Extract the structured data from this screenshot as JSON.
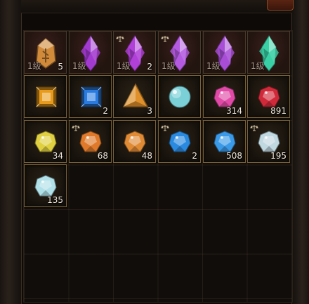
{
  "inventory": {
    "accent": "#7a6236",
    "items": [
      {
        "name": "amber-rune",
        "level": "1级",
        "count": "5",
        "locked": false,
        "color": "#d08a3a"
      },
      {
        "name": "violet-crystal",
        "level": "1级",
        "count": "",
        "locked": false,
        "color": "#a23ad0"
      },
      {
        "name": "violet-crystal-cluster",
        "level": "1级",
        "count": "2",
        "locked": true,
        "color": "#b040d8"
      },
      {
        "name": "violet-crystal-shard",
        "level": "1级",
        "count": "",
        "locked": true,
        "color": "#b45ae0"
      },
      {
        "name": "violet-crystal-shard-2",
        "level": "1级",
        "count": "",
        "locked": false,
        "color": "#a84ed6"
      },
      {
        "name": "teal-crystal",
        "level": "1级",
        "count": "",
        "locked": false,
        "color": "#3ad0a6"
      },
      {
        "name": "topaz-square-gem",
        "level": "",
        "count": "",
        "locked": false,
        "color": "#e89a1a"
      },
      {
        "name": "sapphire-square-gem",
        "level": "",
        "count": "2",
        "locked": false,
        "color": "#2a7be0"
      },
      {
        "name": "amber-triangle-gem",
        "level": "",
        "count": "3",
        "locked": false,
        "color": "#e0902a"
      },
      {
        "name": "cyan-orb",
        "level": "",
        "count": "",
        "locked": false,
        "color": "#7ad0d6"
      },
      {
        "name": "pink-gem",
        "level": "",
        "count": "314",
        "locked": false,
        "color": "#e04aa6"
      },
      {
        "name": "ruby-gem",
        "level": "",
        "count": "891",
        "locked": false,
        "color": "#d02a3a"
      },
      {
        "name": "yellow-gem",
        "level": "",
        "count": "34",
        "locked": false,
        "color": "#e0d040"
      },
      {
        "name": "orange-gem",
        "level": "",
        "count": "68",
        "locked": true,
        "color": "#e07a2a"
      },
      {
        "name": "orange-gem-2",
        "level": "",
        "count": "48",
        "locked": false,
        "color": "#e08a34"
      },
      {
        "name": "blue-gem",
        "level": "",
        "count": "2",
        "locked": true,
        "color": "#2a8ae0"
      },
      {
        "name": "blue-gem-2",
        "level": "",
        "count": "508",
        "locked": false,
        "color": "#3a9ae8"
      },
      {
        "name": "white-gem",
        "level": "",
        "count": "195",
        "locked": true,
        "color": "#c0d8e0"
      },
      {
        "name": "aqua-gem",
        "level": "",
        "count": "135",
        "locked": false,
        "color": "#b0e0e8"
      }
    ]
  }
}
